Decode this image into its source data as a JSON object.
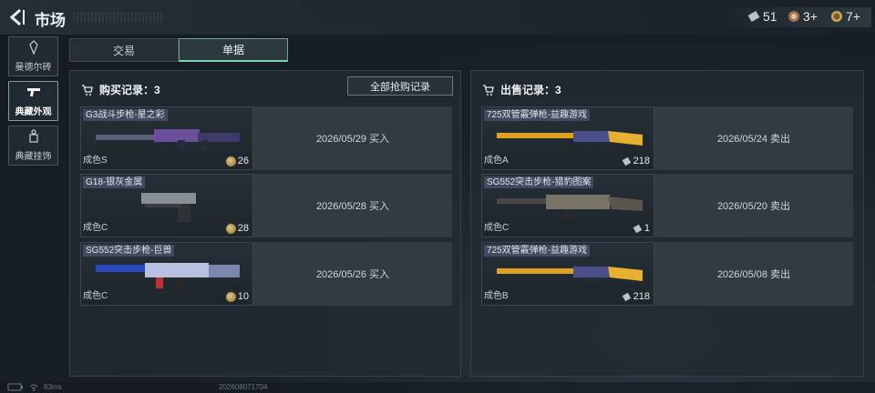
{
  "header": {
    "title": "市场"
  },
  "currencies": [
    {
      "icon": "ticket-icon",
      "value": "51"
    },
    {
      "icon": "badge-icon",
      "value": "3+"
    },
    {
      "icon": "coin-icon",
      "value": "7+"
    }
  ],
  "sidebar": {
    "items": [
      {
        "label": "曼德尔砖",
        "icon": "brick-icon",
        "active": false
      },
      {
        "label": "典藏外观",
        "icon": "pistol-icon",
        "active": true
      },
      {
        "label": "典藏挂饰",
        "icon": "charm-icon",
        "active": false
      }
    ]
  },
  "tabs": [
    {
      "label": "交易",
      "active": false
    },
    {
      "label": "单据",
      "active": true
    }
  ],
  "buy": {
    "title": "购买记录：3",
    "all_button": "全部抢购记录",
    "rows": [
      {
        "name": "G3战斗步枪-星之彩",
        "grade": "成色S",
        "price": "26",
        "info": "2026/05/29 买入"
      },
      {
        "name": "G18-银灰金属",
        "grade": "成色C",
        "price": "28",
        "info": "2026/05/28 买入"
      },
      {
        "name": "SG552突击步枪-巨兽",
        "grade": "成色C",
        "price": "10",
        "info": "2026/05/26 买入"
      }
    ]
  },
  "sell": {
    "title": "出售记录：3",
    "rows": [
      {
        "name": "725双管霰弹枪-益趣游戏",
        "grade": "成色A",
        "price": "218",
        "info": "2026/05/24 卖出"
      },
      {
        "name": "SG552突击步枪-猎豹图案",
        "grade": "成色C",
        "price": "1",
        "info": "2026/05/20 卖出"
      },
      {
        "name": "725双管霰弹枪-益趣游戏",
        "grade": "成色B",
        "price": "218",
        "info": "2026/05/08 卖出"
      }
    ]
  },
  "footer": {
    "latency": "83ms",
    "build": "202608071704"
  },
  "colors": {
    "accent": "#7fd3b1",
    "tab_active_border": "#6fa393"
  }
}
